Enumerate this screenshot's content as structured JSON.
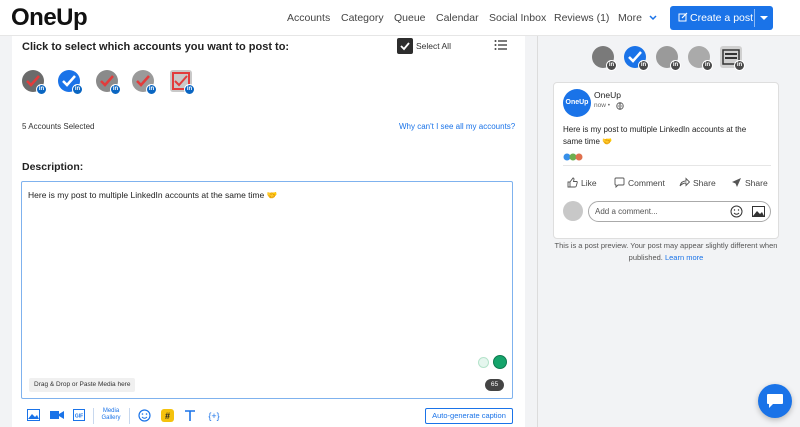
{
  "brand": {
    "logo": "OneUp",
    "accent": "#1a73e8",
    "linkedin": "#0a66c2"
  },
  "nav": {
    "items": [
      {
        "label": "Accounts"
      },
      {
        "label": "Category"
      },
      {
        "label": "Queue"
      },
      {
        "label": "Calendar"
      },
      {
        "label": "Social Inbox"
      },
      {
        "label": "Reviews (1)"
      }
    ],
    "more_label": "More",
    "create_post_label": "Create a post"
  },
  "composer": {
    "select_title": "Click to select which accounts you want to post to:",
    "select_all_label": "Select All",
    "select_all_checked": true,
    "accounts_selected_text": "5 Accounts Selected",
    "why_link": "Why can't I see all my accounts?",
    "description_label": "Description:",
    "description_text": "Here is my post to multiple LinkedIn accounts at the same time 🤝",
    "dropzone_text": "Drag & Drop or Paste Media here",
    "char_count": "65",
    "toolbar": {
      "media_gallery_line1": "Media",
      "media_gallery_line2": "Gallery",
      "autogen_label": "Auto-generate caption"
    }
  },
  "preview": {
    "post_name": "OneUp",
    "avatar_text": "OneUp",
    "post_time": "now •",
    "post_text": "Here is my post to multiple LinkedIn accounts at the same time 🤝",
    "actions": {
      "like": "Like",
      "comment": "Comment",
      "share": "Share",
      "send": "Share"
    },
    "comment_placeholder": "Add a comment...",
    "note_text": "This is a post preview. Your post may appear slightly different when published.",
    "note_link": "Learn more"
  },
  "icons": {
    "account_badge": "linkedin-icon",
    "chat": "chat-bubble-icon"
  }
}
